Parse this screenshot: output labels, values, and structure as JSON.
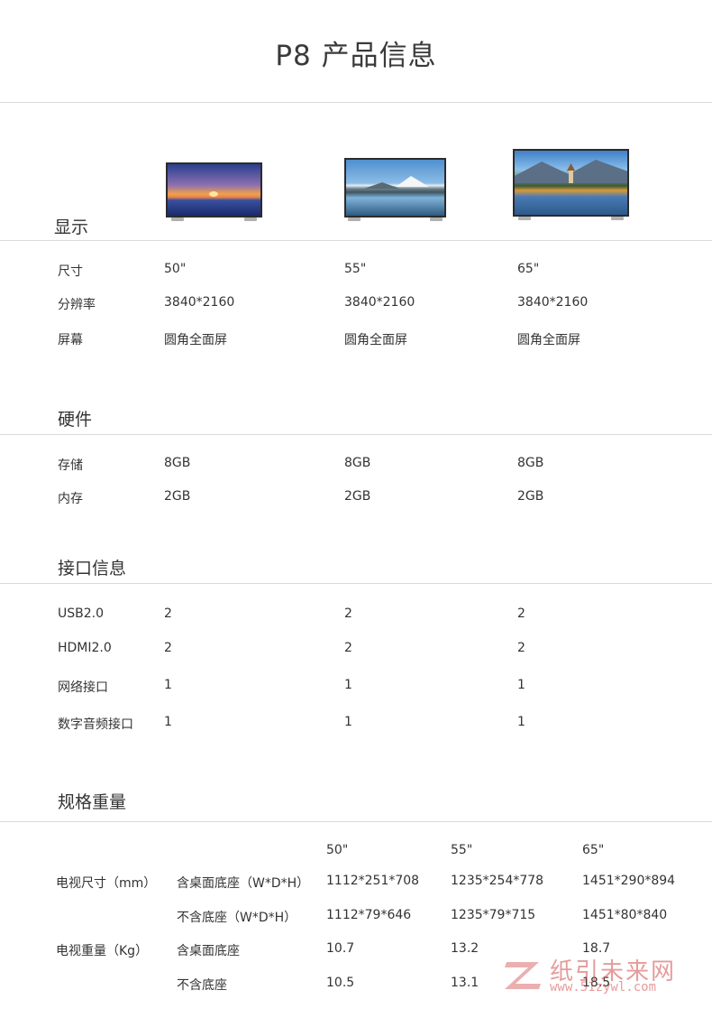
{
  "page_title": "P8 产品信息",
  "sections": {
    "display": "显示",
    "hardware": "硬件",
    "interface": "接口信息",
    "spec": "规格重量"
  },
  "display_rows": [
    {
      "label": "尺寸",
      "v": [
        "50\"",
        "55\"",
        "65\""
      ]
    },
    {
      "label": "分辨率",
      "v": [
        "3840*2160",
        "3840*2160",
        "3840*2160"
      ]
    },
    {
      "label": "屏幕",
      "v": [
        "圆角全面屏",
        "圆角全面屏",
        "圆角全面屏"
      ]
    }
  ],
  "hardware_rows": [
    {
      "label": "存储",
      "v": [
        "8GB",
        "8GB",
        "8GB"
      ]
    },
    {
      "label": "内存",
      "v": [
        "2GB",
        "2GB",
        "2GB"
      ]
    }
  ],
  "interface_rows": [
    {
      "label": "USB2.0",
      "v": [
        "2",
        "2",
        "2"
      ]
    },
    {
      "label": "HDMI2.0",
      "v": [
        "2",
        "2",
        "2"
      ]
    },
    {
      "label": "网络接口",
      "v": [
        "1",
        "1",
        "1"
      ]
    },
    {
      "label": "数字音频接口",
      "v": [
        "1",
        "1",
        "1"
      ]
    }
  ],
  "spec": {
    "sizes": [
      "50\"",
      "55\"",
      "65\""
    ],
    "group1_label": "电视尺寸（mm）",
    "group2_label": "电视重量（Kg）",
    "rows": [
      {
        "label": "含桌面底座（W*D*H）",
        "v": [
          "1112*251*708",
          "1235*254*778",
          "1451*290*894"
        ]
      },
      {
        "label": "不含底座（W*D*H）",
        "v": [
          "1112*79*646",
          "1235*79*715",
          "1451*80*840"
        ]
      },
      {
        "label": "含桌面底座",
        "v": [
          "10.7",
          "13.2",
          "18.7"
        ]
      },
      {
        "label": "不含底座",
        "v": [
          "10.5",
          "13.1",
          "18.5"
        ]
      }
    ]
  },
  "watermark": {
    "text": "纸引未来网",
    "url": "www.51zywl.com"
  },
  "colors": {
    "text": "#333333",
    "divider": "#d9d9d9",
    "watermark": "#d24a4a"
  }
}
